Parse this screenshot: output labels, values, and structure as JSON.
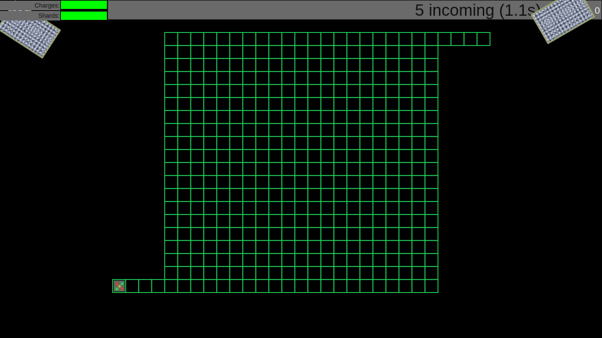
{
  "hud": {
    "charges_label": "Charges:",
    "shards_label": "Shards:",
    "charges_level": 1.0,
    "shards_level": 1.0,
    "wave_text": "5 incoming (1.1s)",
    "score_text": "0"
  },
  "colors": {
    "background": "#000000",
    "grid_line": "#1fd85a",
    "meter_fill": "#00ff00",
    "hud_panel": "#6a6a6a"
  },
  "board": {
    "main_columns": 21,
    "main_rows": 20,
    "top_extra_cells": 4,
    "bottom_extra_cells": 4,
    "player_marker": "player-token-icon"
  }
}
